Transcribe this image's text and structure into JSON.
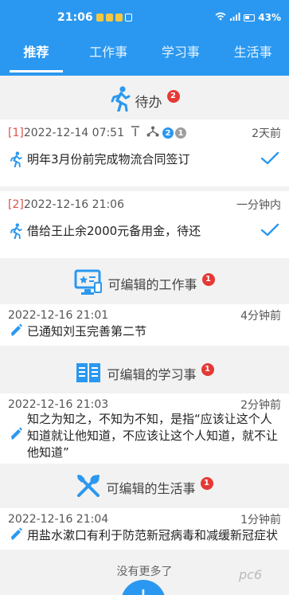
{
  "status": {
    "time": "21:06",
    "battery": "43%"
  },
  "tabs": [
    {
      "label": "推荐",
      "active": true
    },
    {
      "label": "工作事",
      "active": false
    },
    {
      "label": "学习事",
      "active": false
    },
    {
      "label": "生活事",
      "active": false
    }
  ],
  "todo": {
    "title": "待办",
    "count": "2",
    "items": [
      {
        "index": "[1]",
        "datetime": "2022-12-14 07:51",
        "badge_blue": "2",
        "badge_gray": "1",
        "ago": "2天前",
        "text": "明年3月份前完成物流合同签订"
      },
      {
        "index": "[2]",
        "datetime": "2022-12-16 21:06",
        "ago": "一分钟内",
        "text": "借给王止余2000元备用金，待还"
      }
    ]
  },
  "work": {
    "title": "可编辑的工作事",
    "count": "1",
    "item": {
      "datetime": "2022-12-16 21:01",
      "ago": "4分钟前",
      "text": "已通知刘玉完善第二节"
    }
  },
  "study": {
    "title": "可编辑的学习事",
    "count": "1",
    "item": {
      "datetime": "2022-12-16 21:03",
      "ago": "2分钟前",
      "text": "知之为知之，不知为不知，是指“应该让这个人知道就让他知道，不应该让这个人知道，就不让他知道”"
    }
  },
  "life": {
    "title": "可编辑的生活事",
    "count": "1",
    "item": {
      "datetime": "2022-12-16 21:04",
      "ago": "1分钟前",
      "text": "用盐水漱口有利于防范新冠病毒和减缓新冠症状"
    }
  },
  "footer": {
    "no_more": "没有更多了",
    "fab_label": "+"
  },
  "watermark": "pc6",
  "colors": {
    "primary": "#2a98f0",
    "badge": "#e53935",
    "index": "#d9534f"
  }
}
